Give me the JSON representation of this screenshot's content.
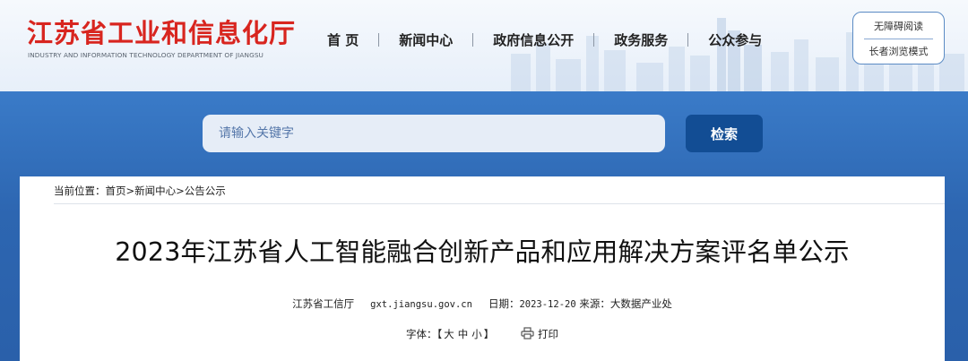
{
  "header": {
    "site_title_cn": "江苏省工业和信息化厅",
    "site_title_en": "INDUSTRY AND INFORMATION TECHNOLOGY DEPARTMENT OF JIANGSU",
    "nav": [
      "首 页",
      "新闻中心",
      "政府信息公开",
      "政务服务",
      "公众参与"
    ],
    "accessibility": {
      "barrier_free": "无障碍阅读",
      "elderly_mode": "长者浏览模式"
    }
  },
  "search": {
    "placeholder": "请输入关键字",
    "button": "检索"
  },
  "breadcrumb": {
    "prefix": "当前位置：",
    "items": [
      "首页",
      "新闻中心",
      "公告公示"
    ],
    "separator": ">"
  },
  "article": {
    "title": "2023年江苏省人工智能融合创新产品和应用解决方案评名单公示",
    "publisher": "江苏省工信厅",
    "domain": "gxt.jiangsu.gov.cn",
    "date_label": "日期：",
    "date": "2023-12-20",
    "source_label": "来源：",
    "source": "大数据产业处"
  },
  "tools": {
    "font_label": "字体：",
    "bracket_open": "【",
    "sizes": [
      "大",
      "中",
      "小"
    ],
    "bracket_close": "】",
    "print": "打印",
    "print_icon": "printer-icon"
  },
  "colors": {
    "brand_red": "#d8251f",
    "band_blue": "#2f69b2",
    "button_blue": "#124d94"
  }
}
